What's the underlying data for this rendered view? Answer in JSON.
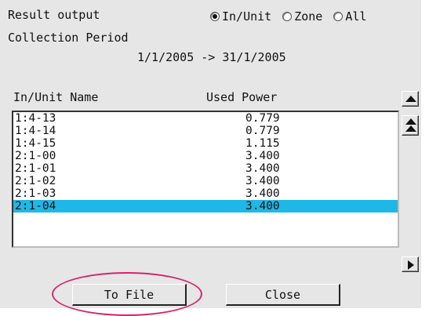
{
  "header": {
    "result_output_label": "Result output",
    "collection_period_label": "Collection Period",
    "period_range": "1/1/2005 -> 31/1/2005"
  },
  "radio_options": [
    {
      "label": "In/Unit",
      "selected": true
    },
    {
      "label": "Zone",
      "selected": false
    },
    {
      "label": "All",
      "selected": false
    }
  ],
  "columns": {
    "name": "In/Unit Name",
    "power": "Used Power"
  },
  "rows": [
    {
      "name": "1:4-13",
      "power": "0.779"
    },
    {
      "name": "1:4-14",
      "power": "0.779"
    },
    {
      "name": "1:4-15",
      "power": "1.115"
    },
    {
      "name": "2:1-00",
      "power": "3.400"
    },
    {
      "name": "2:1-01",
      "power": "3.400"
    },
    {
      "name": "2:1-02",
      "power": "3.400"
    },
    {
      "name": "2:1-03",
      "power": "3.400"
    },
    {
      "name": "2:1-04",
      "power": "3.400",
      "selected": true
    }
  ],
  "buttons": {
    "to_file": "To File",
    "close": "Close"
  },
  "colors": {
    "selection": "#1fb7e6",
    "highlight_ellipse": "#d6246e",
    "panel_background": "#e6e6e6"
  },
  "icons": {
    "scroll_up": "triangle-up-icon",
    "scroll_top": "double-triangle-up-icon",
    "next_page": "triangle-right-icon"
  }
}
